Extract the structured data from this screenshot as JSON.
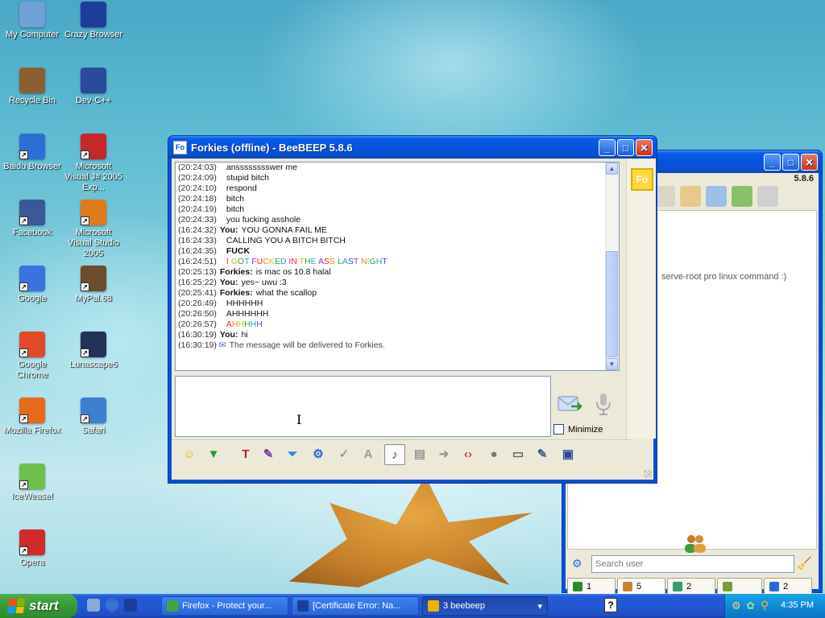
{
  "desktop_icons": [
    {
      "label": "My Computer",
      "icon": "computer-icon",
      "color": "#6fa0d8"
    },
    {
      "label": "Crazy Browser",
      "icon": "star-browser-icon",
      "color": "#1d3d9a"
    },
    {
      "label": "Recycle Bin",
      "icon": "recycle-bin-icon",
      "color": "#8a6032"
    },
    {
      "label": "Dev-C++",
      "icon": "devcpp-icon",
      "color": "#2a4a9a"
    },
    {
      "label": "Baidu Browser",
      "icon": "baidu-icon",
      "color": "#2d6fd6"
    },
    {
      "label": "Microsoft Visual J# 2005 Exp...",
      "icon": "vjsharp-icon",
      "color": "#c62828"
    },
    {
      "label": "Facebook",
      "icon": "facebook-icon",
      "color": "#3b5998"
    },
    {
      "label": "Microsoft Visual Studio 2005",
      "icon": "visual-studio-icon",
      "color": "#e07b1a"
    },
    {
      "label": "Google",
      "icon": "google-icon",
      "color": "#3a73e0"
    },
    {
      "label": "MyPal.68",
      "icon": "mypal-icon",
      "color": "#6d4c2e"
    },
    {
      "label": "Google Chrome",
      "icon": "chrome-icon",
      "color": "#e04a2a"
    },
    {
      "label": "Lunascape6",
      "icon": "lunascape-icon",
      "color": "#22335a"
    },
    {
      "label": "Mozilla Firefox",
      "icon": "firefox-icon",
      "color": "#e66a1a"
    },
    {
      "label": "Safari",
      "icon": "safari-icon",
      "color": "#3f7fcf"
    },
    {
      "label": "IceWeasel",
      "icon": "iceweasel-icon",
      "color": "#6fbf4f"
    },
    {
      "label": "Opera",
      "icon": "opera-icon",
      "color": "#d12a2a"
    }
  ],
  "chat_window": {
    "title": "Forkies (offline) - BeeBEEP 5.8.6",
    "title_icon": "Fo",
    "avatar": "Fo",
    "messages": [
      {
        "ts": "(20:24:03)",
        "who": "",
        "text": "ansssssssswer me",
        "color": "#111111"
      },
      {
        "ts": "(20:24:09)",
        "who": "",
        "text": "stupid bitch",
        "color": "#111111"
      },
      {
        "ts": "(20:24:10)",
        "who": "",
        "text": "respond",
        "color": "#111111"
      },
      {
        "ts": "(20:24:18)",
        "who": "",
        "text": "bitch",
        "color": "#111111"
      },
      {
        "ts": "(20:24:19)",
        "who": "",
        "text": "bitch",
        "color": "#111111"
      },
      {
        "ts": "(20:24:33)",
        "who": "",
        "text": "you fucking asshole",
        "color": "#111111"
      },
      {
        "ts": "(16:24:32)",
        "who": "You:",
        "text": "YOU GONNA FAIL ME",
        "color": "#111111"
      },
      {
        "ts": "(16:24:33)",
        "who": "",
        "text": "CALLING YOU A BITCH BITCH",
        "color": "#111111"
      },
      {
        "ts": "(16:24:35)",
        "who": "",
        "text": "FUCK",
        "color": "#111111",
        "bold": true
      },
      {
        "ts": "(16:24:51)",
        "who": "",
        "text": "I GOT FUCKED IN THE ASS LAST NIGHT",
        "color": "rainbow"
      },
      {
        "ts": "(20:25:13)",
        "who": "Forkies:",
        "text": "is mac os 10.8 halal",
        "color": "#111111"
      },
      {
        "ts": "(16:25:22)",
        "who": "You:",
        "text": "yes~ uwu :3",
        "color": "#111111"
      },
      {
        "ts": "(20:25:41)",
        "who": "Forkies:",
        "text": "what the scallop",
        "color": "#111111"
      },
      {
        "ts": "(20:26:49)",
        "who": "",
        "text": "HHHHHH",
        "color": "#111111"
      },
      {
        "ts": "(20:26:50)",
        "who": "",
        "text": "AHHHHHH",
        "color": "#111111"
      },
      {
        "ts": "(20:26:57)",
        "who": "",
        "text": "AHHHHH",
        "color": "rainbow"
      },
      {
        "ts": "(16:30:19)",
        "who": "You:",
        "text": "hi",
        "color": "#111111"
      },
      {
        "ts": "(16:30:19)",
        "who": "",
        "text": "The message will be delivered to Forkies.",
        "color": "#444444",
        "system": true
      }
    ],
    "minimize_label": "Minimize",
    "toolbar": [
      {
        "icon": "emoticon-icon",
        "glyph": "☺",
        "color": "#e6b800"
      },
      {
        "icon": "emoticon-menu-icon",
        "glyph": "▼",
        "color": "#2a9a2a"
      },
      {
        "icon": "font-icon",
        "glyph": "T",
        "color": "#b22222"
      },
      {
        "icon": "font-color-icon",
        "glyph": "✎",
        "color": "#7a3aa0"
      },
      {
        "icon": "filter-icon",
        "glyph": "⏷",
        "color": "#2a8ad8"
      },
      {
        "icon": "settings-gear-icon",
        "glyph": "⚙",
        "color": "#2a6ad8"
      },
      {
        "icon": "spellcheck-icon",
        "glyph": "✓",
        "color": "#999999"
      },
      {
        "icon": "dictionary-icon",
        "glyph": "A",
        "color": "#999999"
      },
      {
        "icon": "music-note-icon",
        "glyph": "♪",
        "color": "#444444"
      },
      {
        "icon": "document-icon",
        "glyph": "▤",
        "color": "#999999"
      },
      {
        "icon": "file-send-icon",
        "glyph": "➜",
        "color": "#999999"
      },
      {
        "icon": "html-icon",
        "glyph": "‹›",
        "color": "#c84040"
      },
      {
        "icon": "record-icon",
        "glyph": "●",
        "color": "#777777"
      },
      {
        "icon": "screenshot-icon",
        "glyph": "▭",
        "color": "#666666"
      },
      {
        "icon": "save-chat-icon",
        "glyph": "✎",
        "color": "#3a5a9a"
      },
      {
        "icon": "floppy-save-icon",
        "glyph": "▣",
        "color": "#2a4a9a"
      }
    ]
  },
  "main_window": {
    "version": "5.8.6",
    "status_text": "serve-root pro linux command :)",
    "search_placeholder": "Search user",
    "tabs": [
      {
        "icon": "chat-list-icon",
        "label": "1"
      },
      {
        "icon": "users-icon",
        "label": "5"
      },
      {
        "icon": "chat-bubbles-icon",
        "label": "2"
      },
      {
        "icon": "groups-icon",
        "label": ""
      },
      {
        "icon": "files-icon",
        "label": "2"
      }
    ]
  },
  "taskbar": {
    "start_label": "start",
    "tasks": [
      {
        "label": "Firefox - Protect your...",
        "icon": "firefox-task-icon",
        "color": "#3fa53f"
      },
      {
        "label": "[Certificate Error: Na...",
        "icon": "crazy-browser-task-icon",
        "color": "#1d3d9a"
      },
      {
        "label": "3 beebeep",
        "icon": "beebeep-task-icon",
        "color": "#f0b000",
        "active": true
      }
    ],
    "help": "?",
    "clock": "4:35 PM"
  },
  "colors": {
    "accent": "#0a4fd0",
    "desktop_water": "#60bdd3",
    "start_green": "#3a9d3a"
  }
}
